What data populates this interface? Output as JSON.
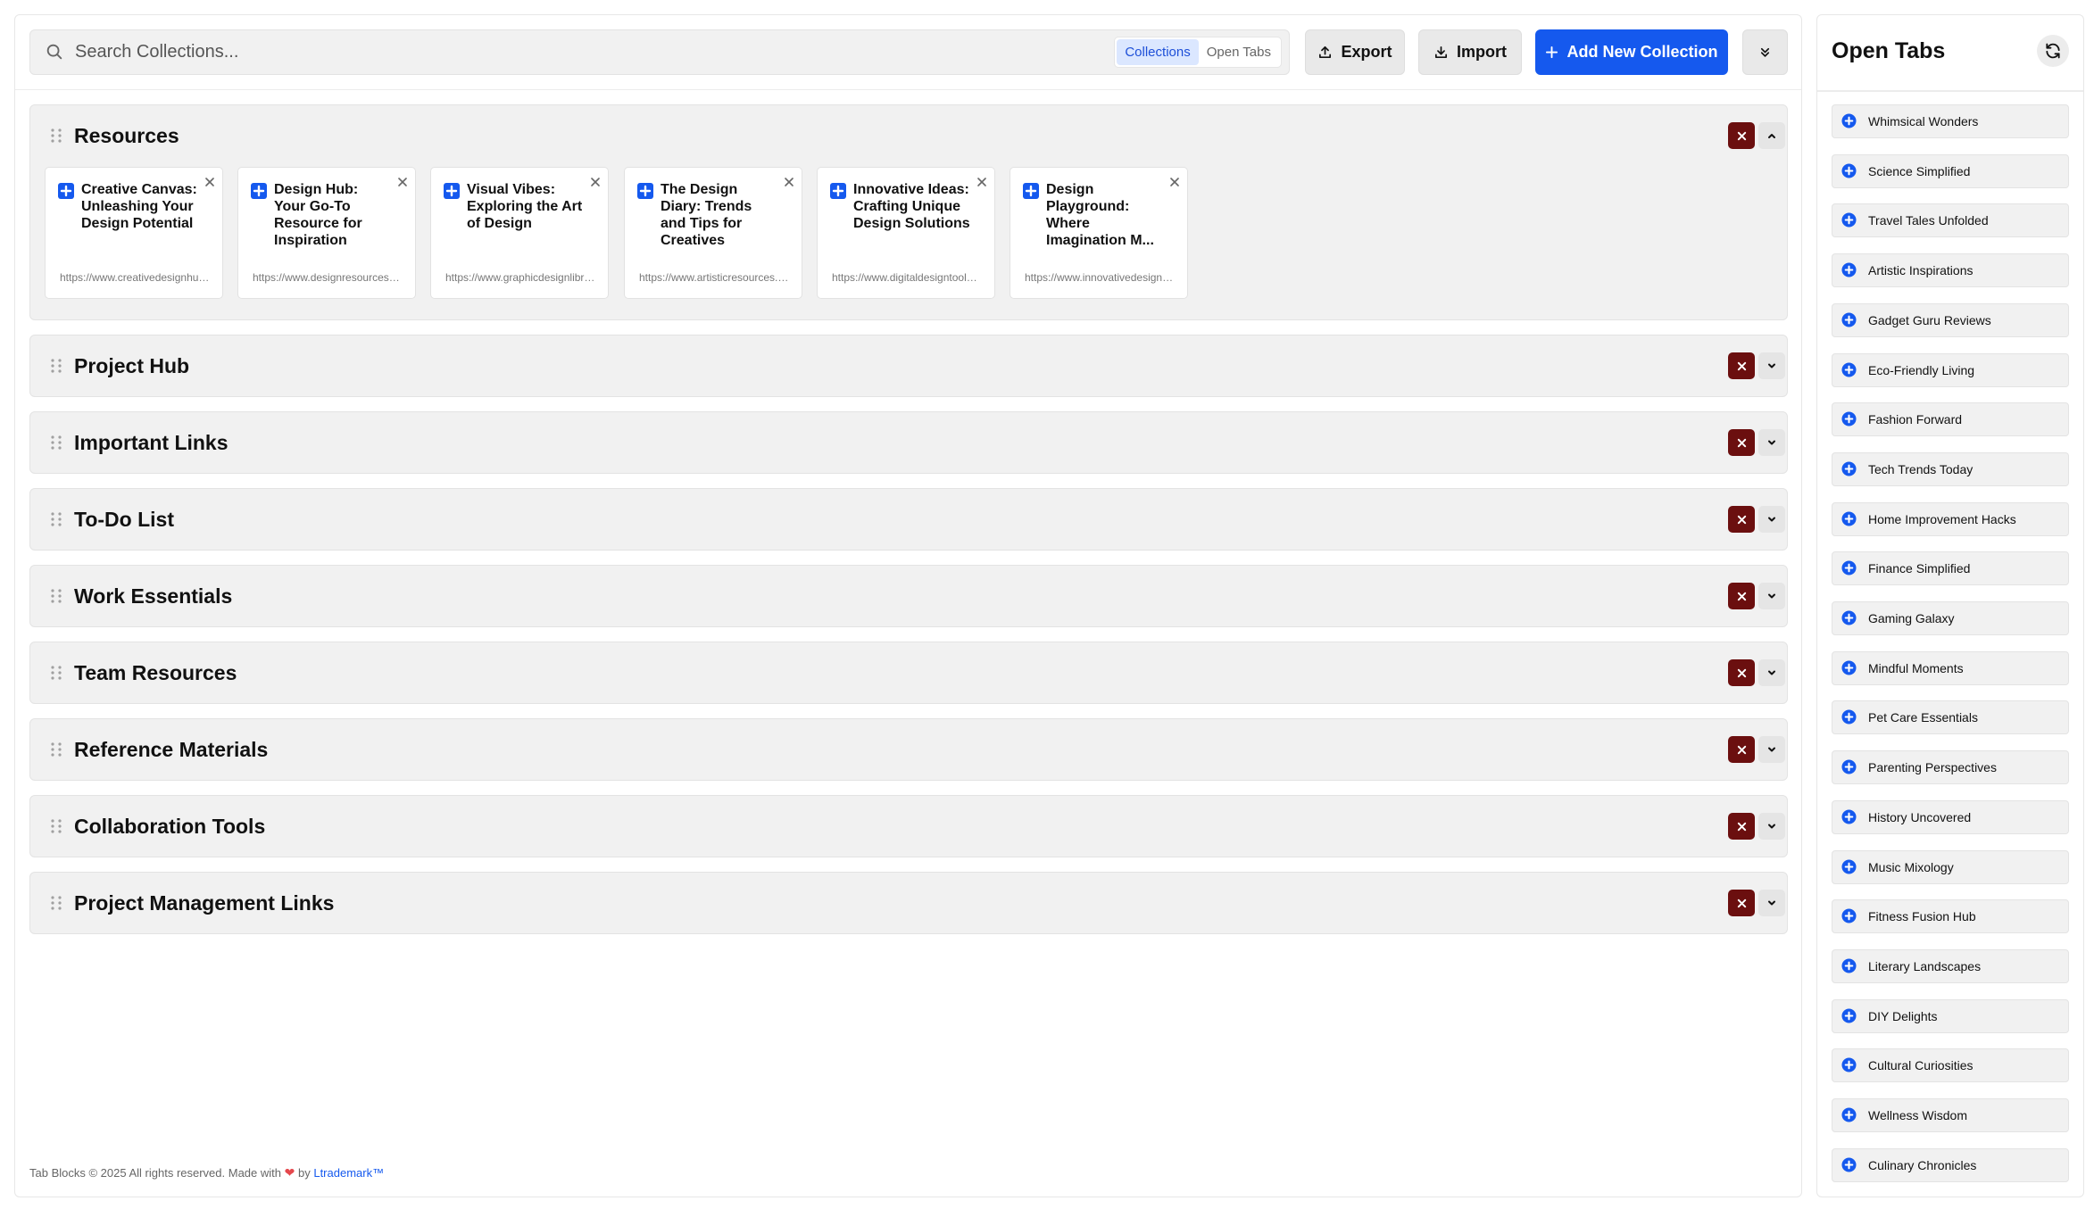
{
  "search": {
    "placeholder": "Search Collections..."
  },
  "view_toggle": {
    "options": [
      "Collections",
      "Open Tabs"
    ],
    "active": "Collections"
  },
  "toolbar": {
    "export_label": "Export",
    "import_label": "Import",
    "add_label": "Add New Collection"
  },
  "collections": [
    {
      "title": "Resources",
      "expanded": true,
      "cards": [
        {
          "title": "Creative Canvas: Unleashing Your Design Potential",
          "url": "https://www.creativedesignhub.com"
        },
        {
          "title": "Design Hub: Your Go-To Resource for Inspiration",
          "url": "https://www.designresources.com"
        },
        {
          "title": "Visual Vibes: Exploring the Art of Design",
          "url": "https://www.graphicdesignlibrary.com"
        },
        {
          "title": "The Design Diary: Trends and Tips for Creatives",
          "url": "https://www.artisticresources.com"
        },
        {
          "title": "Innovative Ideas: Crafting Unique Design Solutions",
          "url": "https://www.digitaldesigntools.com"
        },
        {
          "title": "Design Playground: Where Imagination M...",
          "url": "https://www.innovativedesignstudio.com"
        }
      ]
    },
    {
      "title": "Project Hub",
      "expanded": false
    },
    {
      "title": "Important Links",
      "expanded": false
    },
    {
      "title": "To-Do List",
      "expanded": false
    },
    {
      "title": "Work Essentials",
      "expanded": false
    },
    {
      "title": "Team Resources",
      "expanded": false
    },
    {
      "title": "Reference Materials",
      "expanded": false
    },
    {
      "title": "Collaboration Tools",
      "expanded": false
    },
    {
      "title": "Project Management Links",
      "expanded": false
    }
  ],
  "footer": {
    "text": "Tab Blocks © 2025 All rights reserved. Made with",
    "heart": "❤",
    "by": "by",
    "author": "Ltrademark™"
  },
  "open_tabs": {
    "title": "Open Tabs",
    "items": [
      "Whimsical Wonders",
      "Science Simplified",
      "Travel Tales Unfolded",
      "Artistic Inspirations",
      "Gadget Guru Reviews",
      "Eco-Friendly Living",
      "Fashion Forward",
      "Tech Trends Today",
      "Home Improvement Hacks",
      "Finance Simplified",
      "Gaming Galaxy",
      "Mindful Moments",
      "Pet Care Essentials",
      "Parenting Perspectives",
      "History Uncovered",
      "Music Mixology",
      "Fitness Fusion Hub",
      "Literary Landscapes",
      "DIY Delights",
      "Cultural Curiosities",
      "Wellness Wisdom",
      "Culinary Chronicles"
    ]
  },
  "colors": {
    "accent": "#1559ee",
    "danger": "#6b0f0f",
    "panel": "#f1f1f1"
  }
}
